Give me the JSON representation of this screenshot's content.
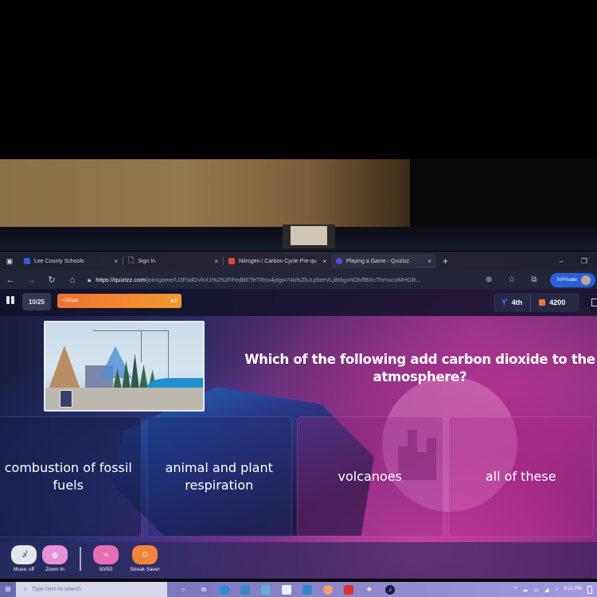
{
  "browser": {
    "tabs": [
      {
        "label": "Lee County Schools",
        "icon": "school-favicon",
        "color": "#2b5fd9"
      },
      {
        "label": "Sign In",
        "icon": "page-icon",
        "color": "#cccccc"
      },
      {
        "label": "Nitrogen / Carbon Cycle Pre-qu",
        "icon": "quiz-favicon",
        "color": "#e04a3a"
      },
      {
        "label": "Playing a Game - Quizizz",
        "icon": "quizizz-favicon",
        "color": "#5b49d6",
        "active": true
      }
    ],
    "new_tab": "+",
    "close_tab": "×",
    "url_host": "https://quizizz.com",
    "url_path": "/join/game/U2FsdGVkX1%252FFedBETeTRco4jdgw74bfsZbJuj9zeVLj8t8gxNObffBXcThmucoMHGB...",
    "inprivate_label": "InPrivate",
    "window_minimize": "–",
    "window_restore": "❐"
  },
  "game": {
    "question_counter": "10/25",
    "bonus_label": "+100pts",
    "streak_count": "3",
    "rank": "4th",
    "score": "4200",
    "question": "Which of the following add carbon dioxide to the atmosphere?",
    "image_alt": "Carbon cycle diagram",
    "answers": [
      {
        "label": "combustion of fossil fuels"
      },
      {
        "label": "animal and plant respiration"
      },
      {
        "label": "volcanoes"
      },
      {
        "label": "all of these"
      }
    ],
    "powerups": [
      {
        "label": "Music off",
        "icon": "music-off-icon"
      },
      {
        "label": "Zoom In",
        "icon": "zoom-in-icon"
      },
      {
        "label": "50/50",
        "icon": "fifty-fifty-icon"
      },
      {
        "label": "Streak Saver",
        "icon": "streak-saver-icon"
      }
    ],
    "accent_orange": "#f07230",
    "accent_blue": "#4a7df0"
  },
  "taskbar": {
    "search_placeholder": "Type here to search",
    "time": "9:21 PM"
  }
}
